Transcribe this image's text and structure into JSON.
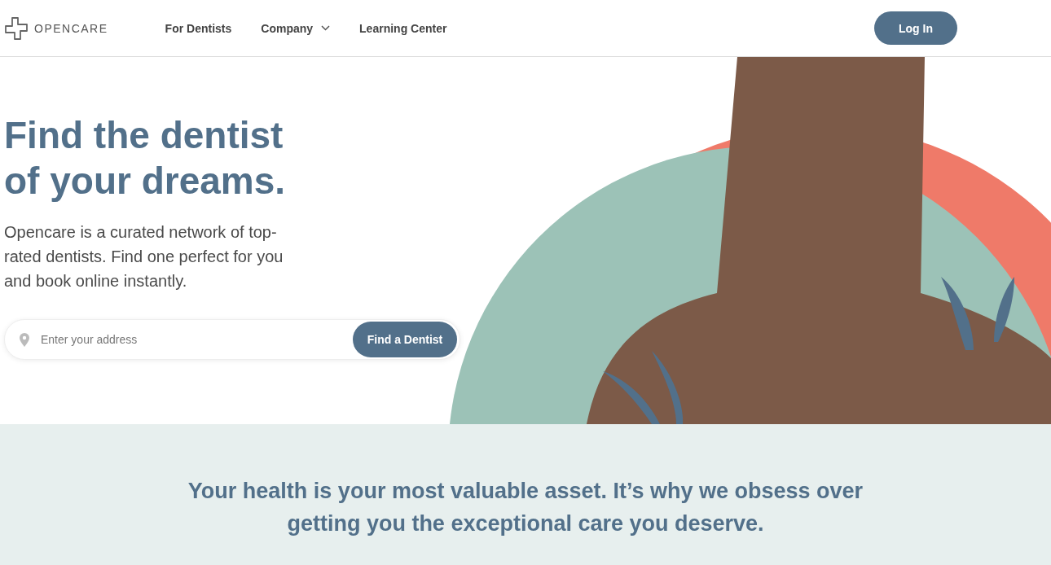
{
  "header": {
    "logo": "OPENCARE",
    "nav": [
      {
        "label": "For Dentists",
        "kind": "link"
      },
      {
        "label": "Company",
        "kind": "dropdown"
      },
      {
        "label": "Learning Center",
        "kind": "link"
      }
    ],
    "login": "Log In"
  },
  "hero": {
    "title": "Find the dentist of your dreams.",
    "text": "Opencare is a curated network of top-rated dentists. Find one perfect for you and book online instantly.",
    "search": {
      "placeholder": "Enter your address"
    },
    "button": "Find a Dentist"
  },
  "mission": {
    "text": "Your health is your most valuable asset. It’s why we obsess over getting you the exceptional care you deserve."
  }
}
